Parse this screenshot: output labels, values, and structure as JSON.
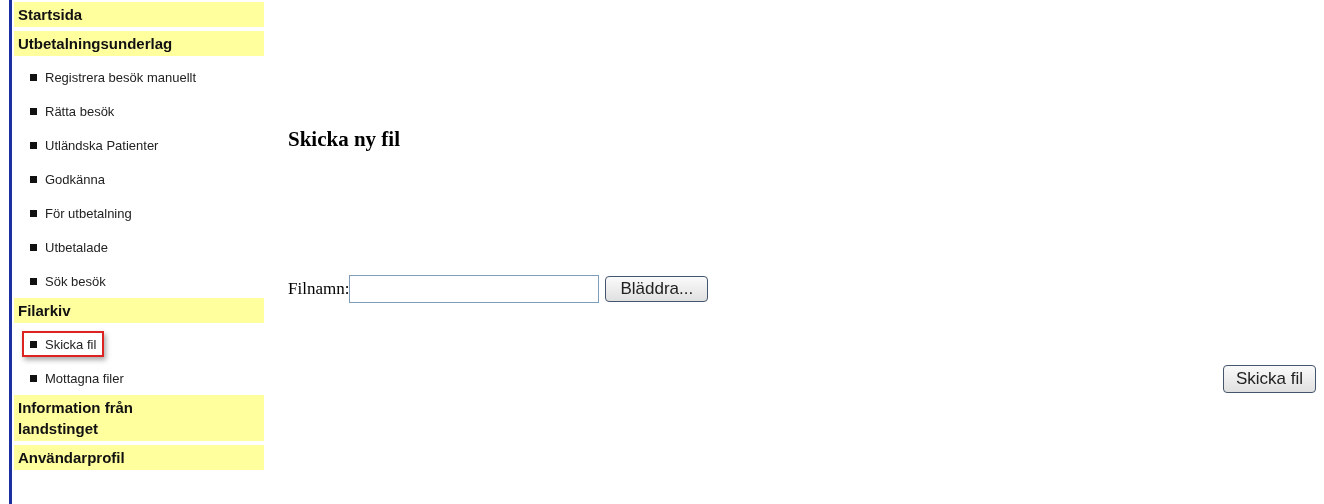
{
  "sidebar": {
    "sections": [
      {
        "title": "Startsida"
      },
      {
        "title": "Utbetalningsunderlag",
        "items": [
          {
            "label": "Registrera besök manuellt",
            "selected": false
          },
          {
            "label": "Rätta besök",
            "selected": false
          },
          {
            "label": "Utländska Patienter",
            "selected": false
          },
          {
            "label": "Godkänna",
            "selected": false
          },
          {
            "label": "För utbetalning",
            "selected": false
          },
          {
            "label": "Utbetalade",
            "selected": false
          },
          {
            "label": "Sök besök",
            "selected": false
          }
        ]
      },
      {
        "title": "Filarkiv",
        "items": [
          {
            "label": "Skicka fil",
            "selected": true
          },
          {
            "label": "Mottagna filer",
            "selected": false
          }
        ]
      },
      {
        "title": "Information från landstinget"
      },
      {
        "title": "Användarprofil"
      }
    ]
  },
  "main": {
    "heading": "Skicka ny fil",
    "file_label": "Filnamn:",
    "browse_button": "Bläddra...",
    "submit_button": "Skicka fil"
  }
}
